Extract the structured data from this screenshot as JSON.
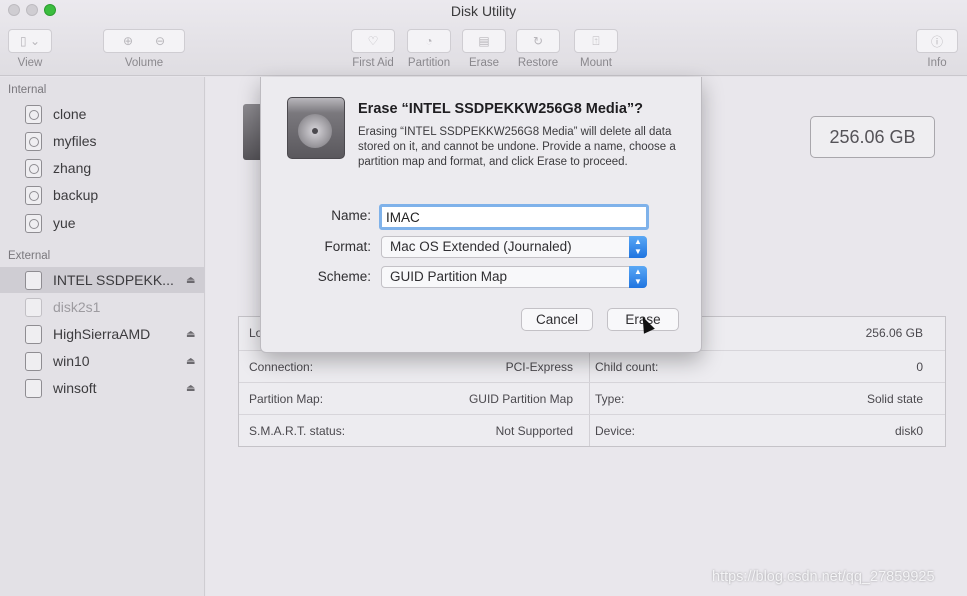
{
  "window": {
    "title": "Disk Utility"
  },
  "toolbar": {
    "view_label": "View",
    "volume_label": "Volume",
    "first_aid_label": "First Aid",
    "partition_label": "Partition",
    "erase_label": "Erase",
    "restore_label": "Restore",
    "mount_label": "Mount",
    "info_label": "Info"
  },
  "sidebar": {
    "internal_header": "Internal",
    "internal_items": [
      {
        "label": "clone"
      },
      {
        "label": "myfiles"
      },
      {
        "label": "zhang"
      },
      {
        "label": "backup"
      },
      {
        "label": "yue"
      }
    ],
    "external_header": "External",
    "external_items": [
      {
        "label": "INTEL SSDPEKK...",
        "selected": true,
        "eject": "⏏"
      },
      {
        "label": "disk2s1",
        "dimmed": true
      },
      {
        "label": "HighSierraAMD",
        "eject": "⏏"
      },
      {
        "label": "win10",
        "eject": "⏏"
      },
      {
        "label": "winsoft",
        "eject": "⏏"
      }
    ]
  },
  "main": {
    "disk_size": "256.06 GB",
    "info": {
      "location_key_partial": "Lo",
      "capacity_value": "256.06 GB",
      "connection_key": "Connection:",
      "connection_value": "PCI-Express",
      "child_count_key": "Child count:",
      "child_count_value": "0",
      "partition_map_key": "Partition Map:",
      "partition_map_value": "GUID Partition Map",
      "type_key": "Type:",
      "type_value": "Solid state",
      "smart_key": "S.M.A.R.T. status:",
      "smart_value": "Not Supported",
      "device_key": "Device:",
      "device_value": "disk0"
    }
  },
  "dialog": {
    "title": "Erase “INTEL SSDPEKKW256G8 Media”?",
    "message": "Erasing “INTEL SSDPEKKW256G8 Media” will delete all data stored on it, and cannot be undone. Provide a name, choose a partition map and format, and click Erase to proceed.",
    "name_label": "Name:",
    "name_value": "IMAC",
    "format_label": "Format:",
    "format_value": "Mac OS Extended (Journaled)",
    "scheme_label": "Scheme:",
    "scheme_value": "GUID Partition Map",
    "cancel_label": "Cancel",
    "erase_label": "Erase"
  },
  "watermark": "https://blog.csdn.net/qq_27859925"
}
